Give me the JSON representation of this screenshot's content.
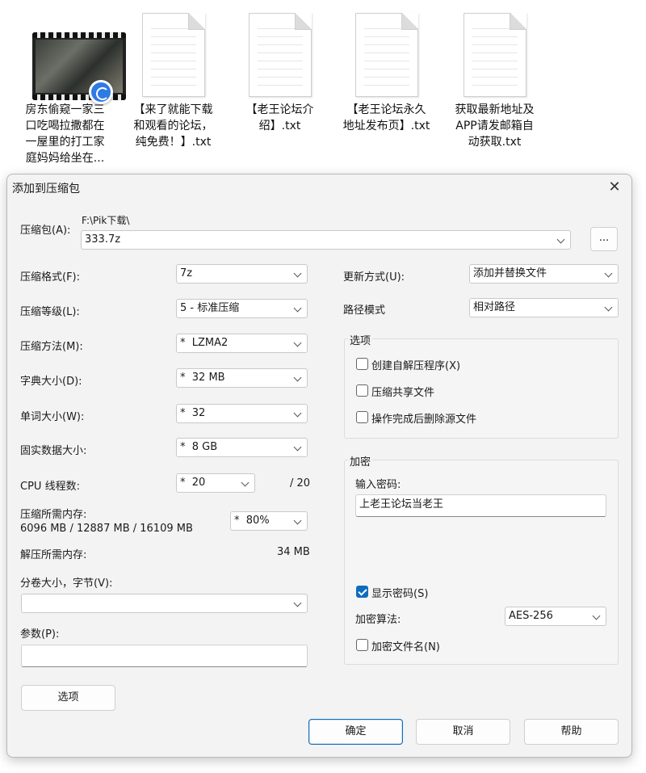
{
  "desktop": {
    "files": [
      {
        "name": "房东偷窥一家三\n口吃喝拉撒都在\n一屋里的打工家\n庭妈妈给坐在...",
        "type": "video"
      },
      {
        "name": "【来了就能下载\n和观看的论坛，\n纯免费！】.txt",
        "type": "txt"
      },
      {
        "name": "【老王论坛介\n绍】.txt",
        "type": "txt"
      },
      {
        "name": "【老王论坛永久\n地址发布页】.txt",
        "type": "txt"
      },
      {
        "name": "获取最新地址及\nAPP请发邮箱自\n动获取.txt",
        "type": "txt"
      }
    ]
  },
  "dialog": {
    "title": "添加到压缩包",
    "archive_label": "压缩包(A):",
    "archive_path": "F:\\Pik下载\\",
    "archive_name": "333.7z",
    "browse_label": "...",
    "format_label": "压缩格式(F):",
    "format_value": "7z",
    "level_label": "压缩等级(L):",
    "level_value": "5 - 标准压缩",
    "method_label": "压缩方法(M):",
    "method_value": "*  LZMA2",
    "dict_label": "字典大小(D):",
    "dict_value": "*  32 MB",
    "word_label": "单词大小(W):",
    "word_value": "*  32",
    "solid_label": "固实数据大小:",
    "solid_value": "*  8 GB",
    "threads_label": "CPU 线程数:",
    "threads_value": "*  20",
    "threads_total": "/ 20",
    "mem_comp_label": "压缩所需内存:",
    "mem_comp_detail": "6096 MB / 12887 MB / 16109 MB",
    "mem_percent_value": "*  80%",
    "mem_decomp_label": "解压所需内存:",
    "mem_decomp_value": "34 MB",
    "volume_label": "分卷大小，字节(V):",
    "volume_value": "",
    "params_label": "参数(P):",
    "params_value": "",
    "options_button": "选项",
    "update_label": "更新方式(U):",
    "update_value": "添加并替换文件",
    "pathmode_label": "路径模式",
    "pathmode_value": "相对路径",
    "options_group": {
      "title": "选项",
      "sfx": {
        "label": "创建自解压程序(X)",
        "checked": false
      },
      "shared": {
        "label": "压缩共享文件",
        "checked": false
      },
      "delete_after": {
        "label": "操作完成后删除源文件",
        "checked": false
      }
    },
    "encryption": {
      "title": "加密",
      "password_label": "输入密码:",
      "password_value": "上老王论坛当老王",
      "show_password": {
        "label": "显示密码(S)",
        "checked": true
      },
      "method_label": "加密算法:",
      "method_value": "AES-256",
      "encrypt_names": {
        "label": "加密文件名(N)",
        "checked": false
      }
    },
    "ok_button": "确定",
    "cancel_button": "取消",
    "help_button": "帮助"
  }
}
